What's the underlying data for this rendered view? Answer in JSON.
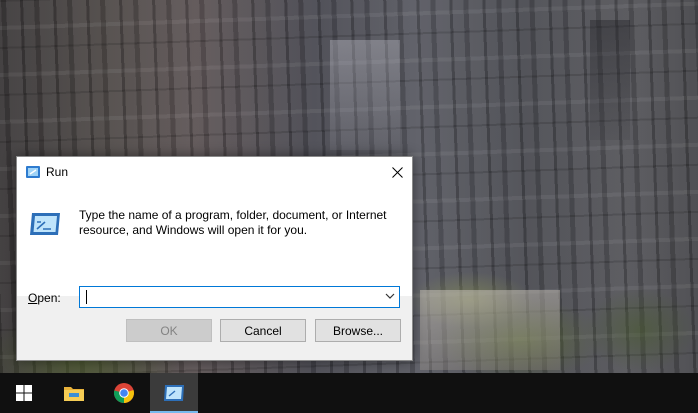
{
  "dialog": {
    "title": "Run",
    "description": "Type the name of a program, folder, document, or Internet resource, and Windows will open it for you.",
    "open_label_prefix": "",
    "open_label_hotkey": "O",
    "open_label_rest": "pen:",
    "open_value": "",
    "buttons": {
      "ok": "OK",
      "cancel": "Cancel",
      "browse": "Browse..."
    }
  },
  "taskbar": {
    "items": [
      "windows-start",
      "file-explorer",
      "google-chrome",
      "run"
    ]
  },
  "colors": {
    "accent": "#0078d7",
    "taskbar": "#101010",
    "dialog_bg": "#f0f0f0"
  }
}
